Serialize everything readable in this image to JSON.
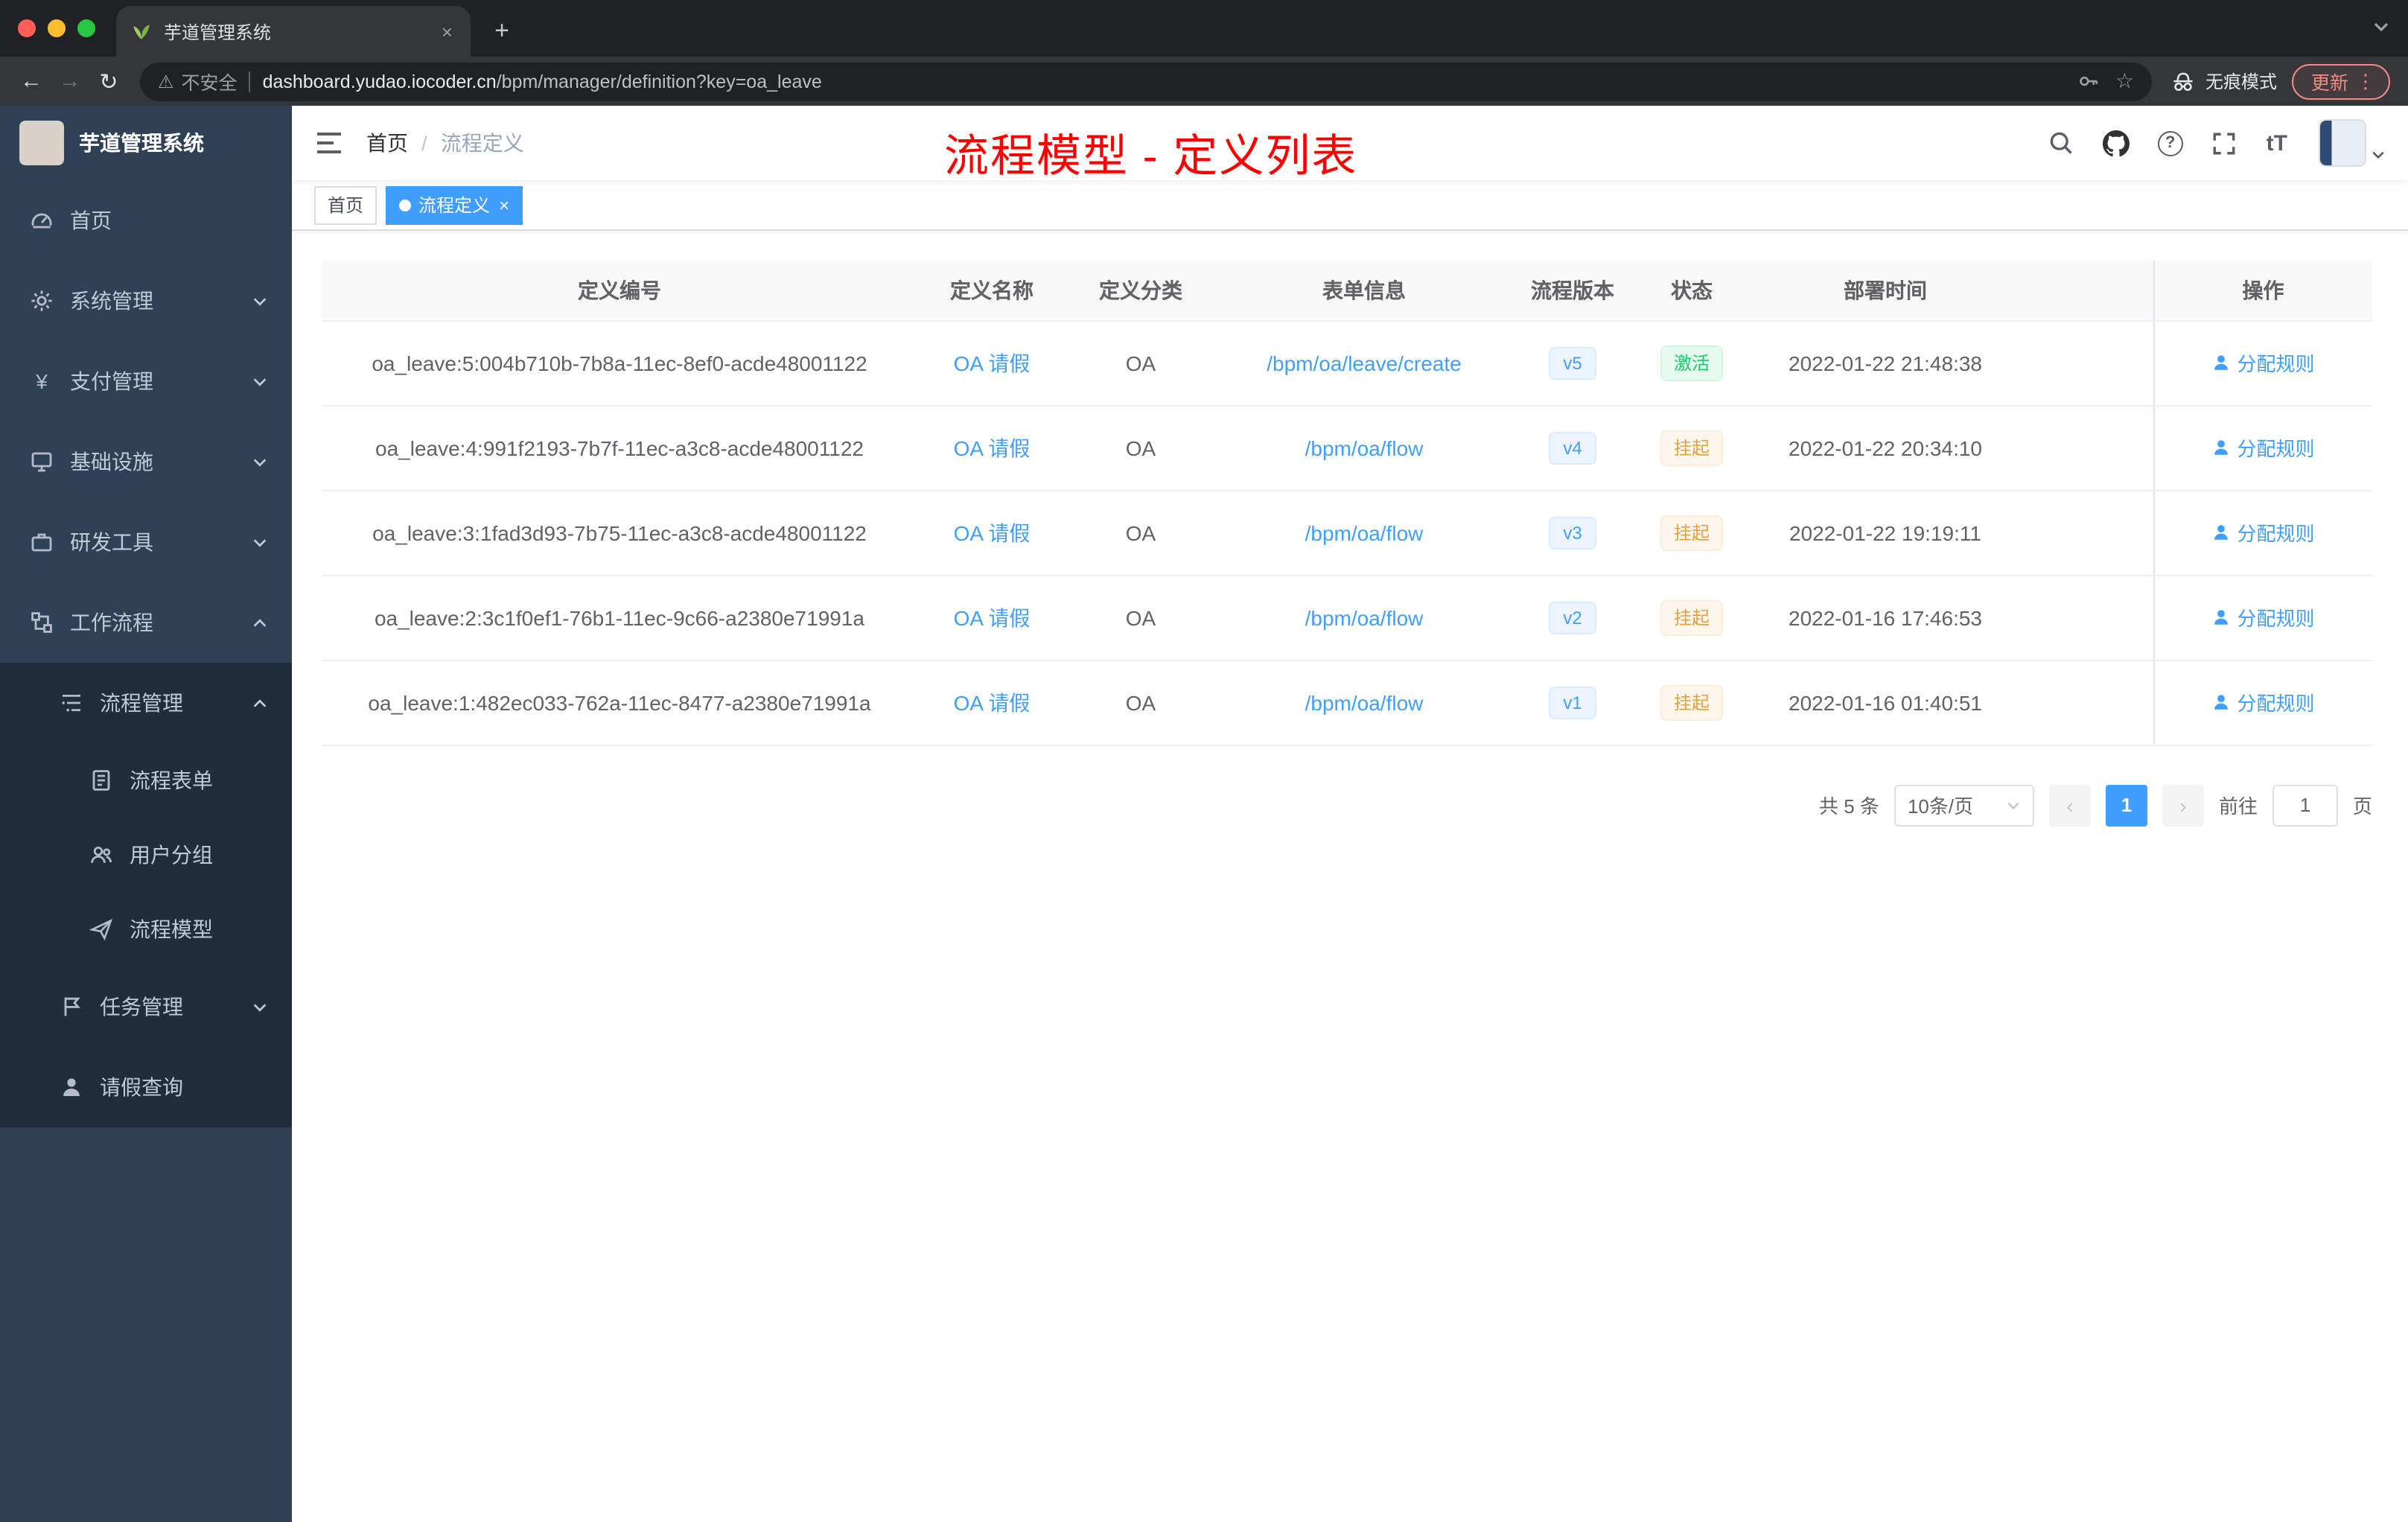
{
  "browser": {
    "tab_title": "芋道管理系统",
    "address": {
      "security_label": "不安全",
      "url_domain": "dashboard.yudao.iocoder.cn",
      "url_path": "/bpm/manager/definition?key=oa_leave"
    },
    "incognito_label": "无痕模式",
    "update_label": "更新"
  },
  "glyphs": {
    "close": "×",
    "new_tab": "+",
    "back": "←",
    "forward": "→",
    "reload": "↻",
    "warning": "⚠",
    "star": "☆",
    "kebab": "⋮",
    "question": "?",
    "font_size": "tT",
    "yen": "¥",
    "prev": "‹",
    "next": "›"
  },
  "sidebar": {
    "logo_title": "芋道管理系统",
    "items": [
      {
        "label": "首页"
      },
      {
        "label": "系统管理",
        "state": "collapsed"
      },
      {
        "label": "支付管理",
        "state": "collapsed"
      },
      {
        "label": "基础设施",
        "state": "collapsed"
      },
      {
        "label": "研发工具",
        "state": "collapsed"
      },
      {
        "label": "工作流程",
        "state": "expanded"
      },
      {
        "label": "流程管理",
        "state": "expanded"
      },
      {
        "label": "流程表单"
      },
      {
        "label": "用户分组"
      },
      {
        "label": "流程模型"
      },
      {
        "label": "任务管理",
        "state": "collapsed"
      },
      {
        "label": "请假查询"
      }
    ]
  },
  "header": {
    "breadcrumb": {
      "home": "首页",
      "separator": "/",
      "current": "流程定义"
    },
    "annotation": "流程模型 - 定义列表"
  },
  "tags": [
    {
      "label": "首页",
      "active": false
    },
    {
      "label": "流程定义",
      "active": true
    }
  ],
  "table": {
    "columns": [
      "定义编号",
      "定义名称",
      "定义分类",
      "表单信息",
      "流程版本",
      "状态",
      "部署时间",
      "操作"
    ],
    "rows": [
      {
        "id": "oa_leave:5:004b710b-7b8a-11ec-8ef0-acde48001122",
        "name": "OA 请假",
        "category": "OA",
        "form": "/bpm/oa/leave/create",
        "version": "v5",
        "status": "激活",
        "time": "2022-01-22 21:48:38",
        "action": "分配规则"
      },
      {
        "id": "oa_leave:4:991f2193-7b7f-11ec-a3c8-acde48001122",
        "name": "OA 请假",
        "category": "OA",
        "form": "/bpm/oa/flow",
        "version": "v4",
        "status": "挂起",
        "time": "2022-01-22 20:34:10",
        "action": "分配规则"
      },
      {
        "id": "oa_leave:3:1fad3d93-7b75-11ec-a3c8-acde48001122",
        "name": "OA 请假",
        "category": "OA",
        "form": "/bpm/oa/flow",
        "version": "v3",
        "status": "挂起",
        "time": "2022-01-22 19:19:11",
        "action": "分配规则"
      },
      {
        "id": "oa_leave:2:3c1f0ef1-76b1-11ec-9c66-a2380e71991a",
        "name": "OA 请假",
        "category": "OA",
        "form": "/bpm/oa/flow",
        "version": "v2",
        "status": "挂起",
        "time": "2022-01-16 17:46:53",
        "action": "分配规则"
      },
      {
        "id": "oa_leave:1:482ec033-762a-11ec-8477-a2380e71991a",
        "name": "OA 请假",
        "category": "OA",
        "form": "/bpm/oa/flow",
        "version": "v1",
        "status": "挂起",
        "time": "2022-01-16 01:40:51",
        "action": "分配规则"
      }
    ]
  },
  "pagination": {
    "total": "共 5 条",
    "page_size": "10条/页",
    "page": "1",
    "goto_prefix": "前往",
    "goto_value": "1",
    "goto_suffix": "页"
  },
  "colors": {
    "accent": "#409eff",
    "success": "#13ce66",
    "warning": "#e6a23c",
    "annotation": "#ff0000",
    "sidebar_bg": "#304156",
    "submenu_bg": "#1f2d3d"
  }
}
